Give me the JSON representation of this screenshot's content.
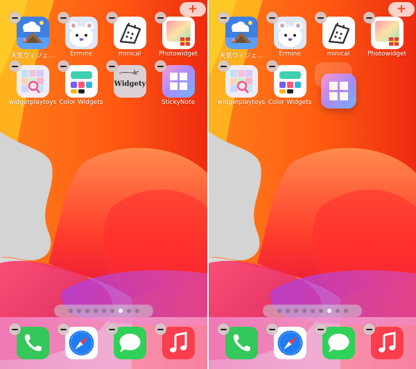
{
  "toolbar": {
    "add_label": "+"
  },
  "page_indicator": {
    "count": 9,
    "active_index": 6
  },
  "left_screen": {
    "apps": [
      {
        "label": "天気ウィジェ…",
        "icon": "weather-widget-icon"
      },
      {
        "label": "Ermine",
        "icon": "ermine-icon"
      },
      {
        "label": "minical",
        "icon": "calendar-icon"
      },
      {
        "label": "Photowidget",
        "icon": "photowidget-icon"
      },
      {
        "label": "widgetplaytoys",
        "icon": "widgetplaytoys-icon"
      },
      {
        "label": "Color Widgets",
        "icon": "color-widgets-icon"
      },
      {
        "label": "",
        "icon": "widgety-icon",
        "icon_text": "Widgety"
      },
      {
        "label": "StickyNote",
        "icon": "stickynote-icon"
      }
    ]
  },
  "right_screen": {
    "apps": [
      {
        "label": "天気ウィジェ…",
        "icon": "weather-widget-icon"
      },
      {
        "label": "Ermine",
        "icon": "ermine-icon"
      },
      {
        "label": "minical",
        "icon": "calendar-icon"
      },
      {
        "label": "Photowidget",
        "icon": "photowidget-icon"
      },
      {
        "label": "widgetplaytoys",
        "icon": "widgetplaytoys-icon"
      },
      {
        "label": "Color Widgets",
        "icon": "color-widgets-icon"
      },
      {
        "label": "",
        "icon": "stickynote-icon",
        "state": "dragging"
      }
    ]
  },
  "dock": {
    "apps": [
      {
        "name": "Phone",
        "icon": "phone-icon"
      },
      {
        "name": "Safari",
        "icon": "safari-icon"
      },
      {
        "name": "Messages",
        "icon": "messages-icon"
      },
      {
        "name": "Music",
        "icon": "music-icon"
      }
    ]
  },
  "colors": {
    "add_button_bg": "#ffffffc7",
    "delete_badge_bg": "#d7c8c8",
    "phone_green": "#34c759",
    "messages_green": "#2fd158",
    "music_red": "#fa3e4e",
    "safari_blue": "#1f7cf2"
  }
}
